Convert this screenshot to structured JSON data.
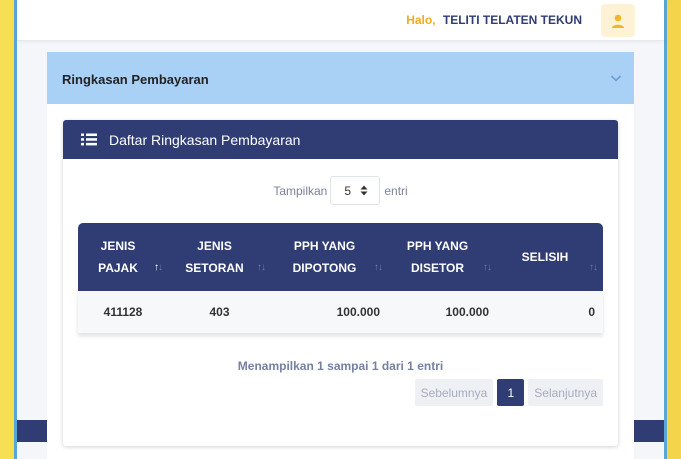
{
  "header": {
    "greeting": "Halo,",
    "username": "TELITI TELATEN TEKUN"
  },
  "accordion": {
    "title": "Ringkasan Pembayaran"
  },
  "card": {
    "title": "Daftar Ringkasan Pembayaran"
  },
  "length_control": {
    "prefix": "Tampilkan",
    "selected": "5",
    "suffix": "entri"
  },
  "table": {
    "columns": [
      {
        "line1": "JENIS",
        "line2": "PAJAK",
        "sort": "asc"
      },
      {
        "line1": "JENIS",
        "line2": "SETORAN",
        "sort": "none"
      },
      {
        "line1": "PPH YANG",
        "line2": "DIPOTONG",
        "sort": "none"
      },
      {
        "line1": "PPH YANG",
        "line2": "DISETOR",
        "sort": "none"
      },
      {
        "line1": "SELISIH",
        "line2": "",
        "sort": "none"
      }
    ],
    "rows": [
      [
        "411128",
        "403",
        "100.000",
        "100.000",
        "0"
      ]
    ]
  },
  "info_text": "Menampilkan 1 sampai 1 dari 1 entri",
  "pagination": {
    "prev": "Sebelumnya",
    "current": "1",
    "next": "Selanjutnya"
  },
  "colors": {
    "navy": "#2f3d74",
    "accent_orange": "#f0ad1c",
    "accordion_blue": "#a9d0f5"
  },
  "icons": {
    "avatar": "user-icon",
    "accordion": "chevron-down-icon",
    "card": "list-icon",
    "select": "sort-arrows-icon"
  }
}
